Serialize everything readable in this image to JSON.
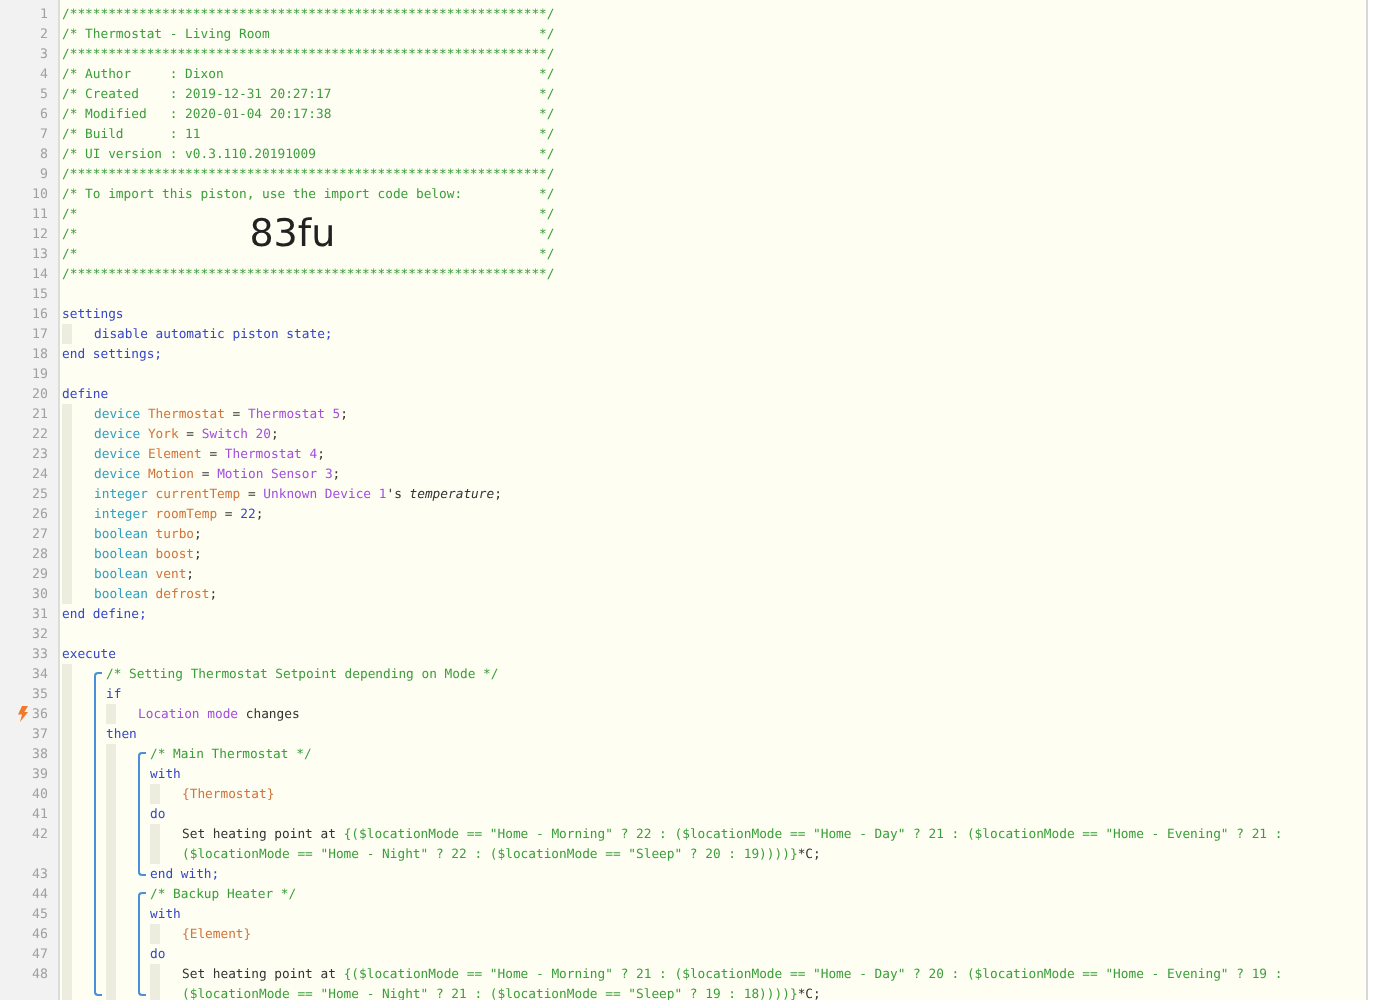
{
  "editor": {
    "items": [
      {
        "kind": "line",
        "number": "1",
        "tokens": [
          {
            "text": "/**************************************************************/",
            "kind": "comment"
          }
        ]
      },
      {
        "kind": "line",
        "number": "2",
        "tokens": [
          {
            "text": "/* Thermostat - Living Room",
            "kind": "comment"
          },
          {
            "text": "*/",
            "kind": "end"
          }
        ]
      },
      {
        "kind": "line",
        "number": "3",
        "tokens": [
          {
            "text": "/**************************************************************/",
            "kind": "comment"
          }
        ]
      },
      {
        "kind": "line",
        "number": "4",
        "tokens": [
          {
            "text": "/* Author     : Dixon",
            "kind": "comment"
          },
          {
            "text": "*/",
            "kind": "end"
          }
        ]
      },
      {
        "kind": "line",
        "number": "5",
        "tokens": [
          {
            "text": "/* Created    : 2019-12-31 20:27:17",
            "kind": "comment"
          },
          {
            "text": "*/",
            "kind": "end"
          }
        ]
      },
      {
        "kind": "line",
        "number": "6",
        "tokens": [
          {
            "text": "/* Modified   : 2020-01-04 20:17:38",
            "kind": "comment"
          },
          {
            "text": "*/",
            "kind": "end"
          }
        ]
      },
      {
        "kind": "line",
        "number": "7",
        "tokens": [
          {
            "text": "/* Build      : 11",
            "kind": "comment"
          },
          {
            "text": "*/",
            "kind": "end"
          }
        ]
      },
      {
        "kind": "line",
        "number": "8",
        "tokens": [
          {
            "text": "/* UI version : v0.3.110.20191009",
            "kind": "comment"
          },
          {
            "text": "*/",
            "kind": "end"
          }
        ]
      },
      {
        "kind": "line",
        "number": "9",
        "tokens": [
          {
            "text": "/**************************************************************/",
            "kind": "comment"
          }
        ]
      },
      {
        "kind": "line",
        "number": "10",
        "tokens": [
          {
            "text": "/* To import this piston, use the import code below:",
            "kind": "comment"
          },
          {
            "text": "*/",
            "kind": "end"
          }
        ]
      },
      {
        "kind": "line",
        "number": "11",
        "tokens": [
          {
            "text": "/*",
            "kind": "comment"
          },
          {
            "text": "*/",
            "kind": "end"
          }
        ]
      },
      {
        "kind": "line",
        "number": "12",
        "tokens": [
          {
            "text": "/*",
            "kind": "comment"
          },
          {
            "text": "83fu",
            "kind": "code"
          },
          {
            "text": "*/",
            "kind": "end"
          }
        ]
      },
      {
        "kind": "line",
        "number": "13",
        "tokens": [
          {
            "text": "/*",
            "kind": "comment"
          },
          {
            "text": "*/",
            "kind": "end"
          }
        ]
      },
      {
        "kind": "line",
        "number": "14",
        "tokens": [
          {
            "text": "/**************************************************************/",
            "kind": "comment"
          }
        ]
      },
      {
        "kind": "line",
        "number": "15"
      },
      {
        "kind": "line",
        "number": "16",
        "tokens": [
          {
            "text": "settings",
            "kind": "kw"
          }
        ]
      },
      {
        "kind": "body",
        "children": [
          {
            "kind": "line",
            "number": "17",
            "tokens": [
              {
                "text": "disable automatic piston state;",
                "kind": "kw"
              }
            ]
          }
        ]
      },
      {
        "kind": "line",
        "number": "18",
        "tokens": [
          {
            "text": "end settings;",
            "kind": "kw"
          }
        ]
      },
      {
        "kind": "line",
        "number": "19"
      },
      {
        "kind": "line",
        "number": "20",
        "tokens": [
          {
            "text": "define",
            "kind": "kw"
          }
        ]
      },
      {
        "kind": "body",
        "children": [
          {
            "kind": "line",
            "number": "21",
            "tokens": [
              {
                "text": "device ",
                "kind": "type"
              },
              {
                "text": "Thermostat",
                "kind": "var"
              },
              {
                "text": " = ",
                "kind": "plain"
              },
              {
                "text": "Thermostat 5",
                "kind": "dev"
              },
              {
                "text": ";",
                "kind": "plain"
              }
            ]
          },
          {
            "kind": "line",
            "number": "22",
            "tokens": [
              {
                "text": "device ",
                "kind": "type"
              },
              {
                "text": "York",
                "kind": "var"
              },
              {
                "text": " = ",
                "kind": "plain"
              },
              {
                "text": "Switch 20",
                "kind": "dev"
              },
              {
                "text": ";",
                "kind": "plain"
              }
            ]
          },
          {
            "kind": "line",
            "number": "23",
            "tokens": [
              {
                "text": "device ",
                "kind": "type"
              },
              {
                "text": "Element",
                "kind": "var"
              },
              {
                "text": " = ",
                "kind": "plain"
              },
              {
                "text": "Thermostat 4",
                "kind": "dev"
              },
              {
                "text": ";",
                "kind": "plain"
              }
            ]
          },
          {
            "kind": "line",
            "number": "24",
            "tokens": [
              {
                "text": "device ",
                "kind": "type"
              },
              {
                "text": "Motion",
                "kind": "var"
              },
              {
                "text": " = ",
                "kind": "plain"
              },
              {
                "text": "Motion Sensor 3",
                "kind": "dev"
              },
              {
                "text": ";",
                "kind": "plain"
              }
            ]
          },
          {
            "kind": "line",
            "number": "25",
            "tokens": [
              {
                "text": "integer ",
                "kind": "type"
              },
              {
                "text": "currentTemp",
                "kind": "var"
              },
              {
                "text": " = ",
                "kind": "plain"
              },
              {
                "text": "Unknown Device 1",
                "kind": "dev"
              },
              {
                "text": "'s ",
                "kind": "plain"
              },
              {
                "text": "temperature",
                "kind": "italic"
              },
              {
                "text": ";",
                "kind": "plain"
              }
            ]
          },
          {
            "kind": "line",
            "number": "26",
            "tokens": [
              {
                "text": "integer ",
                "kind": "type"
              },
              {
                "text": "roomTemp",
                "kind": "var"
              },
              {
                "text": " = ",
                "kind": "plain"
              },
              {
                "text": "22",
                "kind": "num"
              },
              {
                "text": ";",
                "kind": "plain"
              }
            ]
          },
          {
            "kind": "line",
            "number": "27",
            "tokens": [
              {
                "text": "boolean ",
                "kind": "type"
              },
              {
                "text": "turbo",
                "kind": "var"
              },
              {
                "text": ";",
                "kind": "plain"
              }
            ]
          },
          {
            "kind": "line",
            "number": "28",
            "tokens": [
              {
                "text": "boolean ",
                "kind": "type"
              },
              {
                "text": "boost",
                "kind": "var"
              },
              {
                "text": ";",
                "kind": "plain"
              }
            ]
          },
          {
            "kind": "line",
            "number": "29",
            "tokens": [
              {
                "text": "boolean ",
                "kind": "type"
              },
              {
                "text": "vent",
                "kind": "var"
              },
              {
                "text": ";",
                "kind": "plain"
              }
            ]
          },
          {
            "kind": "line",
            "number": "30",
            "tokens": [
              {
                "text": "boolean ",
                "kind": "type"
              },
              {
                "text": "defrost",
                "kind": "var"
              },
              {
                "text": ";",
                "kind": "plain"
              }
            ]
          }
        ]
      },
      {
        "kind": "line",
        "number": "31",
        "tokens": [
          {
            "text": "end define;",
            "kind": "kw"
          }
        ]
      },
      {
        "kind": "line",
        "number": "32"
      },
      {
        "kind": "line",
        "number": "33",
        "tokens": [
          {
            "text": "execute",
            "kind": "kw"
          }
        ]
      },
      {
        "kind": "body",
        "children": [
          {
            "kind": "bracket",
            "children": [
              {
                "kind": "line",
                "number": "34",
                "tokens": [
                  {
                    "text": "/* Setting Thermostat Setpoint depending on Mode */",
                    "kind": "comment"
                  }
                ]
              },
              {
                "kind": "line",
                "number": "35",
                "tokens": [
                  {
                    "text": "if",
                    "kind": "kw"
                  }
                ]
              },
              {
                "kind": "body",
                "children": [
                  {
                    "kind": "line",
                    "number": "36",
                    "trigger": true,
                    "tokens": [
                      {
                        "text": "Location mode",
                        "kind": "dev"
                      },
                      {
                        "text": " changes",
                        "kind": "plain"
                      }
                    ]
                  }
                ]
              },
              {
                "kind": "line",
                "number": "37",
                "tokens": [
                  {
                    "text": "then",
                    "kind": "kw"
                  }
                ]
              },
              {
                "kind": "body",
                "children": [
                  {
                    "kind": "bracket",
                    "children": [
                      {
                        "kind": "line",
                        "number": "38",
                        "tokens": [
                          {
                            "text": "/* Main Thermostat */",
                            "kind": "comment"
                          }
                        ]
                      },
                      {
                        "kind": "line",
                        "number": "39",
                        "tokens": [
                          {
                            "text": "with",
                            "kind": "kw"
                          }
                        ]
                      },
                      {
                        "kind": "body",
                        "children": [
                          {
                            "kind": "line",
                            "number": "40",
                            "tokens": [
                              {
                                "text": "{Thermostat}",
                                "kind": "var"
                              }
                            ]
                          }
                        ]
                      },
                      {
                        "kind": "line",
                        "number": "41",
                        "tokens": [
                          {
                            "text": "do",
                            "kind": "kw"
                          }
                        ]
                      },
                      {
                        "kind": "body",
                        "children": [
                          {
                            "kind": "line",
                            "number": "42",
                            "tokens": [
                              {
                                "text": "Set heating point at ",
                                "kind": "plain"
                              },
                              {
                                "text": "{($locationMode == \"Home - Morning\" ? 22 : ($locationMode == \"Home - Day\" ? 21 : ($locationMode == \"Home - Evening\" ? 21 :",
                                "kind": "expr"
                              }
                            ]
                          },
                          {
                            "kind": "line",
                            "tokens": [
                              {
                                "text": "($locationMode == \"Home - Night\" ? 22 : ($locationMode == \"Sleep\" ? 20 : 19))))}",
                                "kind": "expr"
                              },
                              {
                                "text": "*C;",
                                "kind": "plain"
                              }
                            ]
                          }
                        ]
                      },
                      {
                        "kind": "line",
                        "number": "43",
                        "tokens": [
                          {
                            "text": "end with;",
                            "kind": "kw"
                          }
                        ]
                      }
                    ]
                  },
                  {
                    "kind": "bracket",
                    "children": [
                      {
                        "kind": "line",
                        "number": "44",
                        "tokens": [
                          {
                            "text": "/* Backup Heater */",
                            "kind": "comment"
                          }
                        ]
                      },
                      {
                        "kind": "line",
                        "number": "45",
                        "tokens": [
                          {
                            "text": "with",
                            "kind": "kw"
                          }
                        ]
                      },
                      {
                        "kind": "body",
                        "children": [
                          {
                            "kind": "line",
                            "number": "46",
                            "tokens": [
                              {
                                "text": "{Element}",
                                "kind": "var"
                              }
                            ]
                          }
                        ]
                      },
                      {
                        "kind": "line",
                        "number": "47",
                        "tokens": [
                          {
                            "text": "do",
                            "kind": "kw"
                          }
                        ]
                      },
                      {
                        "kind": "body",
                        "children": [
                          {
                            "kind": "line",
                            "number": "48",
                            "tokens": [
                              {
                                "text": "Set heating point at ",
                                "kind": "plain"
                              },
                              {
                                "text": "{($locationMode == \"Home - Morning\" ? 21 : ($locationMode == \"Home - Day\" ? 20 : ($locationMode == \"Home - Evening\" ? 19 :",
                                "kind": "expr"
                              }
                            ]
                          },
                          {
                            "kind": "line",
                            "tokens": [
                              {
                                "text": "($locationMode == \"Home - Night\" ? 21 : ($locationMode == \"Sleep\" ? 19 : 18))))}",
                                "kind": "expr"
                              },
                              {
                                "text": "*C;",
                                "kind": "plain"
                              }
                            ]
                          }
                        ]
                      }
                    ]
                  }
                ]
              }
            ]
          }
        ]
      }
    ]
  }
}
